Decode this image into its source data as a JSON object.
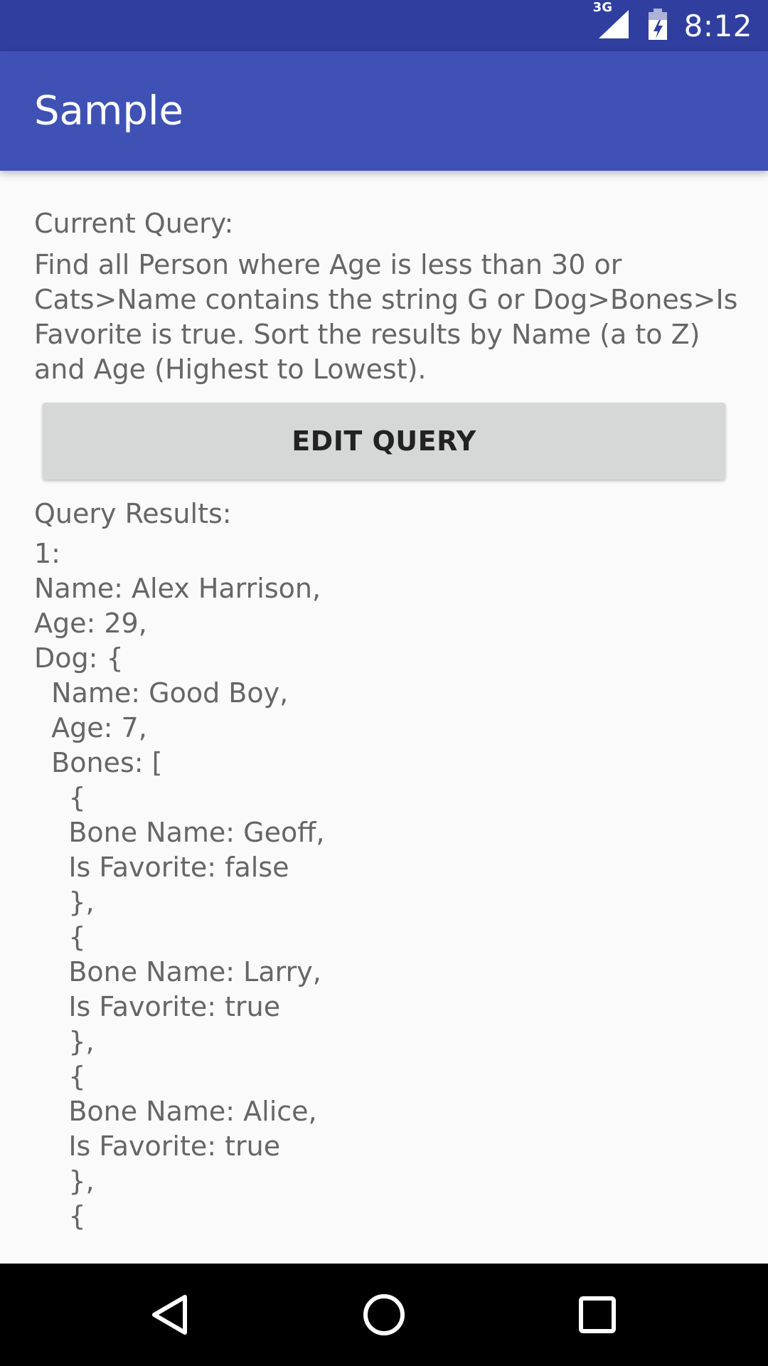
{
  "status_bar": {
    "network": "3G",
    "time": "8:12"
  },
  "app_bar": {
    "title": "Sample"
  },
  "query": {
    "label": "Current Query:",
    "text": "Find all Person where Age is less than 30 or Cats>Name contains the string G or Dog>Bones>Is Favorite is true. Sort the results by Name (a to Z) and Age (Highest to Lowest).",
    "edit_button_label": "EDIT QUERY"
  },
  "results": {
    "label": "Query Results:",
    "text": "1:\nName: Alex Harrison,\nAge: 29,\nDog: {\n  Name: Good Boy,\n  Age: 7,\n  Bones: [\n    {\n    Bone Name: Geoff,\n    Is Favorite: false\n    },\n    {\n    Bone Name: Larry,\n    Is Favorite: true\n    },\n    {\n    Bone Name: Alice,\n    Is Favorite: true\n    },\n    {"
  },
  "nav": {
    "back_icon": "back-icon",
    "home_icon": "home-icon",
    "recents_icon": "recents-icon"
  }
}
